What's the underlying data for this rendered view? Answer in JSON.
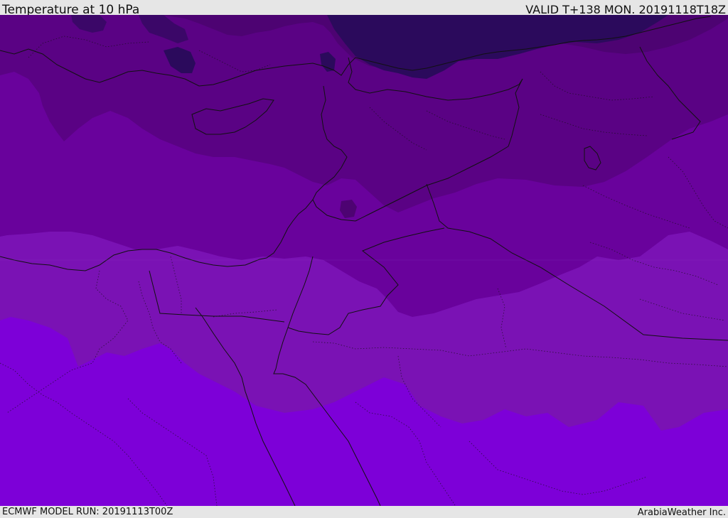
{
  "header": {
    "title": "Temperature at 10 hPa",
    "valid_time": "VALID T+138 MON. 20191118T18Z"
  },
  "footer": {
    "model_run": "ECMWF MODEL RUN: 20191113T00Z",
    "credit": "ArabiaWeather Inc."
  },
  "map": {
    "parameter": "temperature",
    "level": "10 hPa",
    "shading_colors": {
      "coldest": "#2b0a5c",
      "very_cold": "#4d0372",
      "cold": "#5a0284",
      "moderate": "#69029c",
      "mild": "#7a12b4",
      "warmest": "#7d00d8"
    },
    "line_colors": {
      "coastline": "#111111",
      "border": "#111111"
    }
  }
}
